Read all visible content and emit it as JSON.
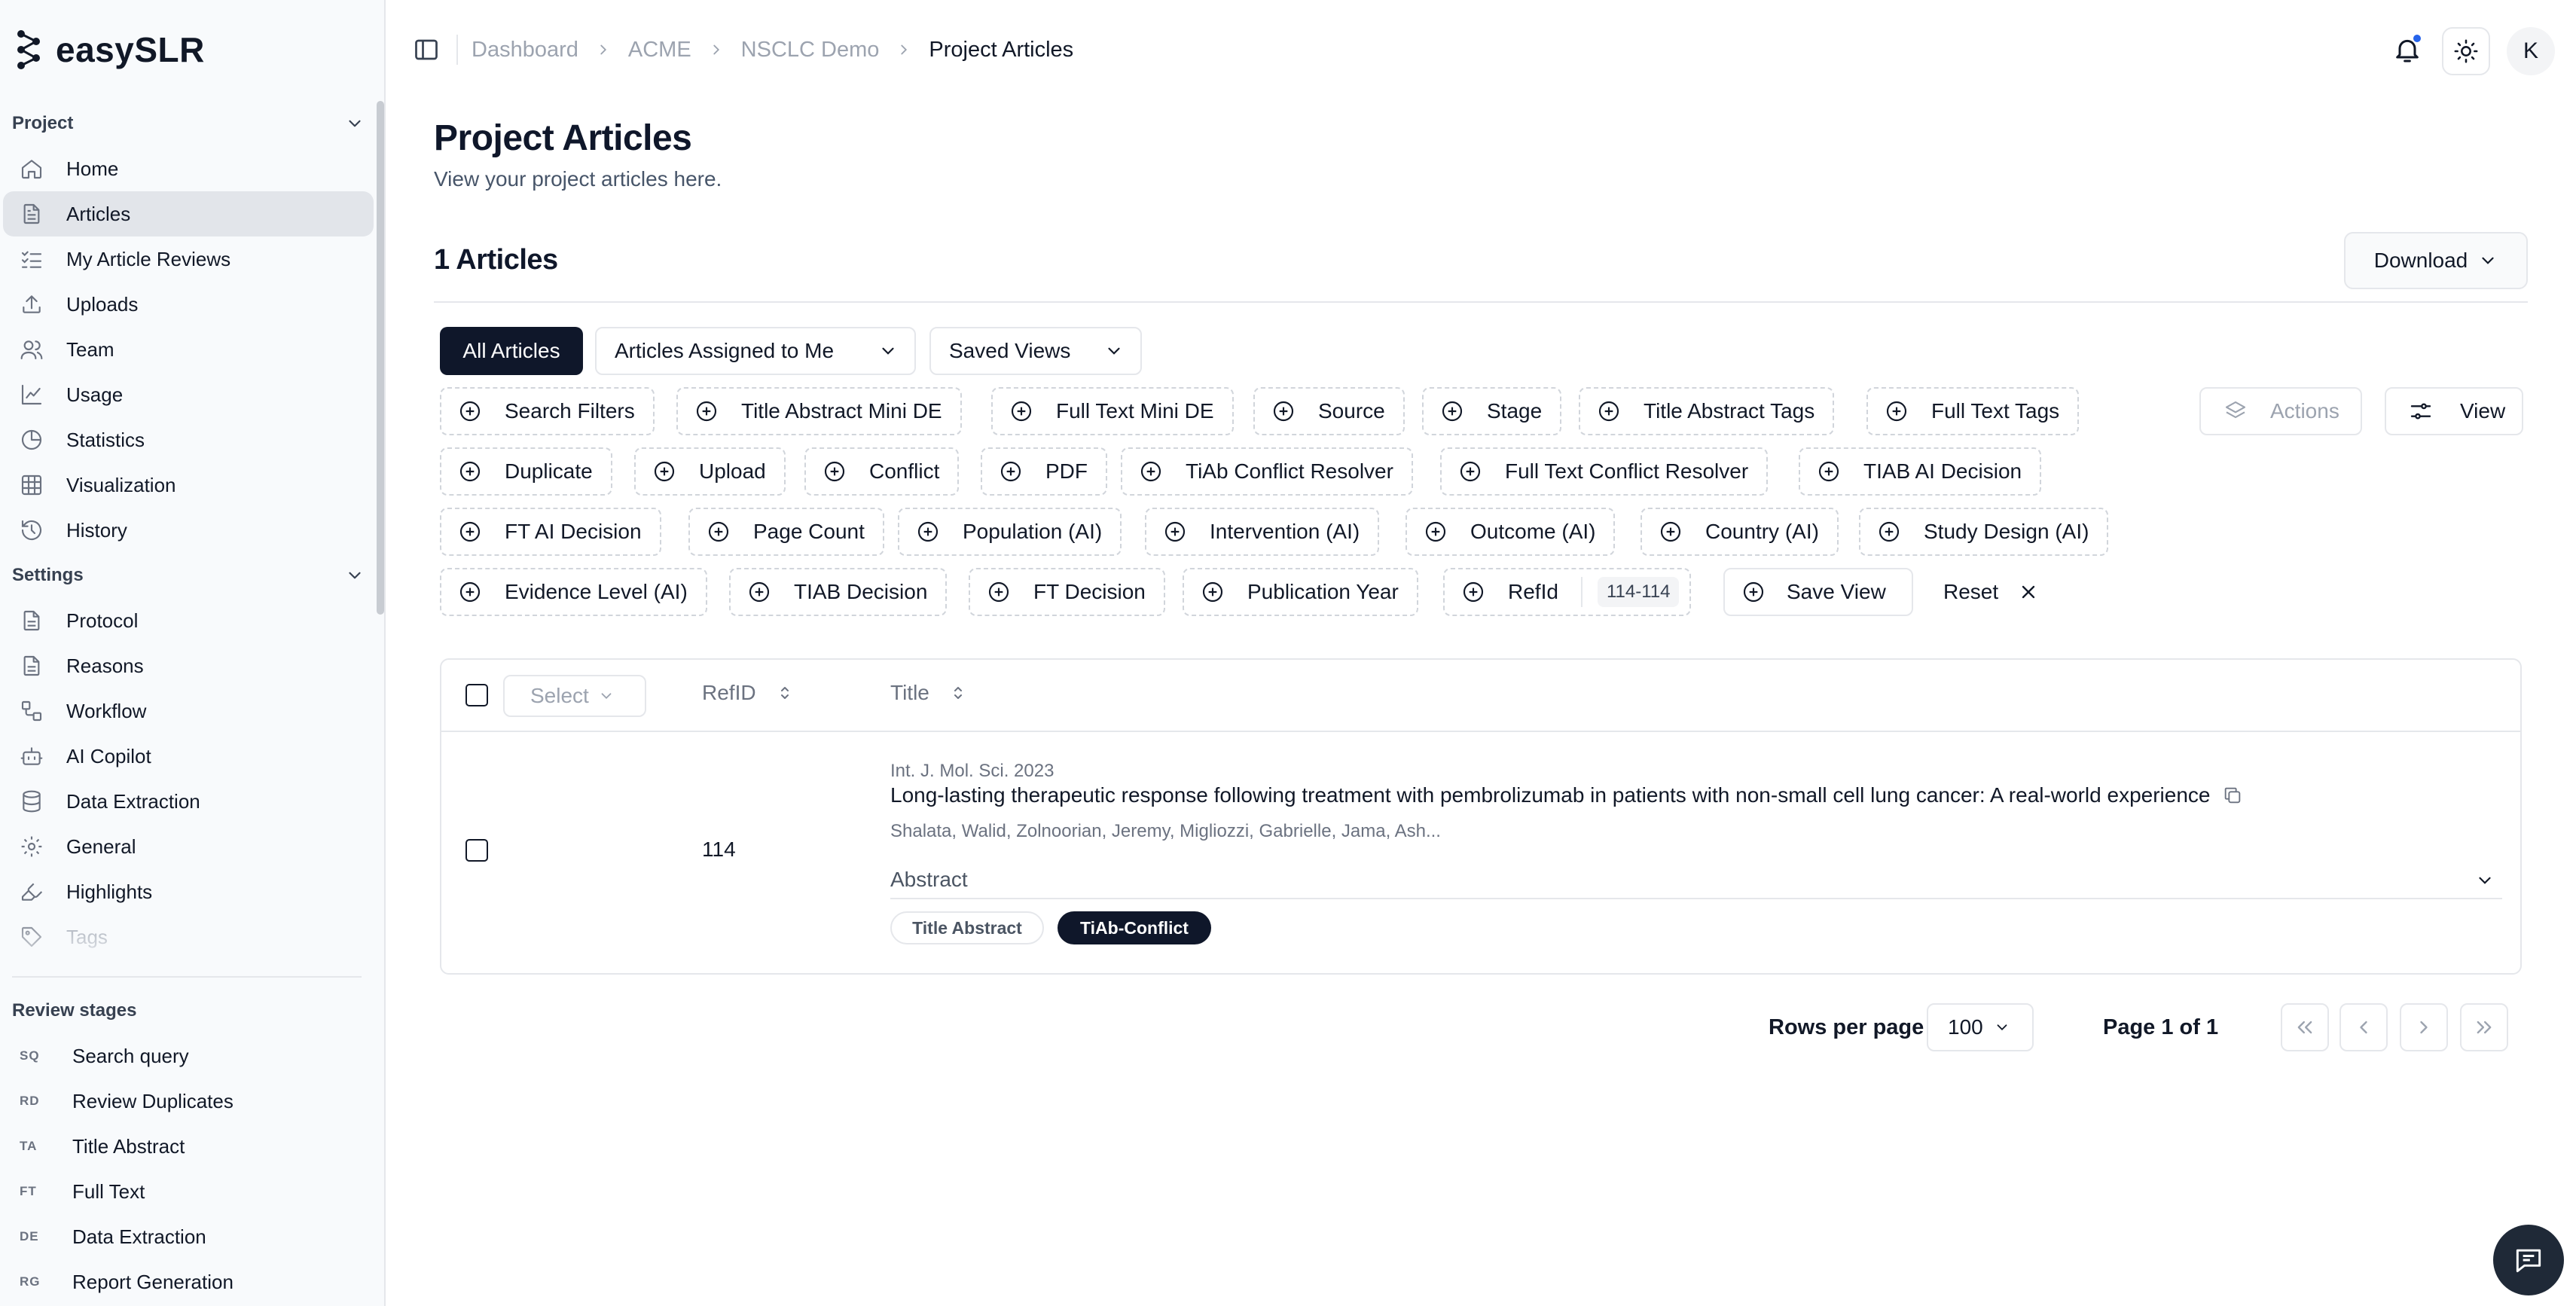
{
  "app": {
    "name": "easySLR"
  },
  "sidebar": {
    "project_group": "Project",
    "project_items": [
      {
        "label": "Home",
        "icon": "home-icon"
      },
      {
        "label": "Articles",
        "icon": "file-text-icon",
        "active": true
      },
      {
        "label": "My Article Reviews",
        "icon": "list-check-icon"
      },
      {
        "label": "Uploads",
        "icon": "upload-icon"
      },
      {
        "label": "Team",
        "icon": "users-icon"
      },
      {
        "label": "Usage",
        "icon": "line-chart-icon"
      },
      {
        "label": "Statistics",
        "icon": "pie-chart-icon"
      },
      {
        "label": "Visualization",
        "icon": "grid-icon"
      },
      {
        "label": "History",
        "icon": "history-icon"
      }
    ],
    "settings_group": "Settings",
    "settings_items": [
      {
        "label": "Protocol",
        "icon": "file-icon"
      },
      {
        "label": "Reasons",
        "icon": "file-icon"
      },
      {
        "label": "Workflow",
        "icon": "workflow-icon"
      },
      {
        "label": "AI Copilot",
        "icon": "bot-icon"
      },
      {
        "label": "Data Extraction",
        "icon": "database-icon"
      },
      {
        "label": "General",
        "icon": "gear-icon"
      },
      {
        "label": "Highlights",
        "icon": "highlighter-icon"
      },
      {
        "label": "Tags",
        "icon": "tags-icon"
      }
    ],
    "review_stages_title": "Review stages",
    "review_stages": [
      {
        "abbr": "SQ",
        "label": "Search query"
      },
      {
        "abbr": "RD",
        "label": "Review Duplicates"
      },
      {
        "abbr": "TA",
        "label": "Title Abstract"
      },
      {
        "abbr": "FT",
        "label": "Full Text"
      },
      {
        "abbr": "DE",
        "label": "Data Extraction"
      },
      {
        "abbr": "RG",
        "label": "Report Generation"
      }
    ]
  },
  "breadcrumb": [
    "Dashboard",
    "ACME",
    "NSCLC Demo",
    "Project Articles"
  ],
  "user": {
    "avatar_initial": "K"
  },
  "page": {
    "title": "Project Articles",
    "subtitle": "View your project articles here.",
    "count_label": "1 Articles",
    "download_label": "Download"
  },
  "views": {
    "all": "All Articles",
    "assigned": "Articles Assigned to Me",
    "saved": "Saved Views"
  },
  "filters": {
    "row1": [
      "Search Filters",
      "Title Abstract Mini DE",
      "Full Text Mini DE",
      "Source",
      "Stage",
      "Title Abstract Tags",
      "Full Text Tags"
    ],
    "row2": [
      "Duplicate",
      "Upload",
      "Conflict",
      "PDF",
      "TiAb Conflict Resolver",
      "Full Text Conflict Resolver",
      "TIAB AI Decision"
    ],
    "row3": [
      "FT AI Decision",
      "Page Count",
      "Population (AI)",
      "Intervention (AI)",
      "Outcome (AI)",
      "Country (AI)",
      "Study Design (AI)"
    ],
    "row4": [
      "Evidence Level (AI)",
      "TIAB Decision",
      "FT Decision",
      "Publication Year",
      "RefId"
    ],
    "refid_range": "114-114",
    "save_view": "Save View",
    "reset": "Reset",
    "actions": "Actions",
    "view": "View"
  },
  "table": {
    "select_label": "Select",
    "columns": [
      "RefID",
      "Title"
    ],
    "rows": [
      {
        "refid": "114",
        "journal": "Int. J. Mol. Sci. 2023",
        "title": "Long-lasting therapeutic response following treatment with pembrolizumab in patients with non-small cell lung cancer: A real-world experience",
        "authors": "Shalata, Walid, Zolnoorian, Jeremy, Migliozzi, Gabrielle, Jama, Ash...",
        "abstract_label": "Abstract",
        "badges": [
          "Title Abstract",
          "TiAb-Conflict"
        ]
      }
    ]
  },
  "pagination": {
    "rows_per_page_label": "Rows per page",
    "rows_per_page": "100",
    "page_info": "Page 1 of 1"
  }
}
